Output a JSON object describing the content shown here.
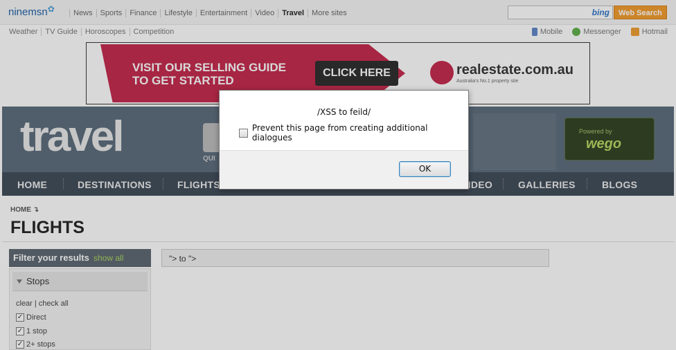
{
  "header": {
    "logo": "ninemsn",
    "nav": [
      "News",
      "Sports",
      "Finance",
      "Lifestyle",
      "Entertainment",
      "Video",
      "Travel",
      "More sites"
    ],
    "active_nav": "Travel",
    "search_placeholder": "",
    "search_engine": "bing",
    "search_button": "Web Search",
    "subnav": [
      "Weather",
      "TV Guide",
      "Horoscopes",
      "Competition"
    ],
    "right_links": [
      "Mobile",
      "Messenger",
      "Hotmail"
    ]
  },
  "ad": {
    "text_line1": "VISIT OUR SELLING GUIDE",
    "text_line2": "TO GET STARTED",
    "button": "CLICK HERE",
    "brand": "realestate.com.au",
    "tagline": "Australia's No.1 property site"
  },
  "travel": {
    "wordmark": "travel",
    "quick_label": "QUI",
    "powered_by": "Powered by",
    "partner": "wego"
  },
  "main_nav": [
    "HOME",
    "DESTINATIONS",
    "FLIGHTS",
    "VIDEO",
    "GALLERIES",
    "BLOGS"
  ],
  "page": {
    "breadcrumb": "HOME",
    "title": "FLIGHTS",
    "route": "\"> to \">"
  },
  "filter": {
    "title": "Filter your results",
    "show_all": "show all",
    "section": "Stops",
    "clear_check": "clear | check all",
    "options": [
      {
        "label": "Direct",
        "checked": true
      },
      {
        "label": "1 stop",
        "checked": true
      },
      {
        "label": "2+ stops",
        "checked": true
      }
    ]
  },
  "dialog": {
    "message": "/XSS to feild/",
    "checkbox_label": "Prevent this page from creating additional dialogues",
    "ok_button": "OK"
  },
  "colors": {
    "nav_bg": "#3d4a57",
    "search_button": "#f29a2b",
    "ad_red": "#c4264a",
    "show_all": "#a7d45f"
  }
}
